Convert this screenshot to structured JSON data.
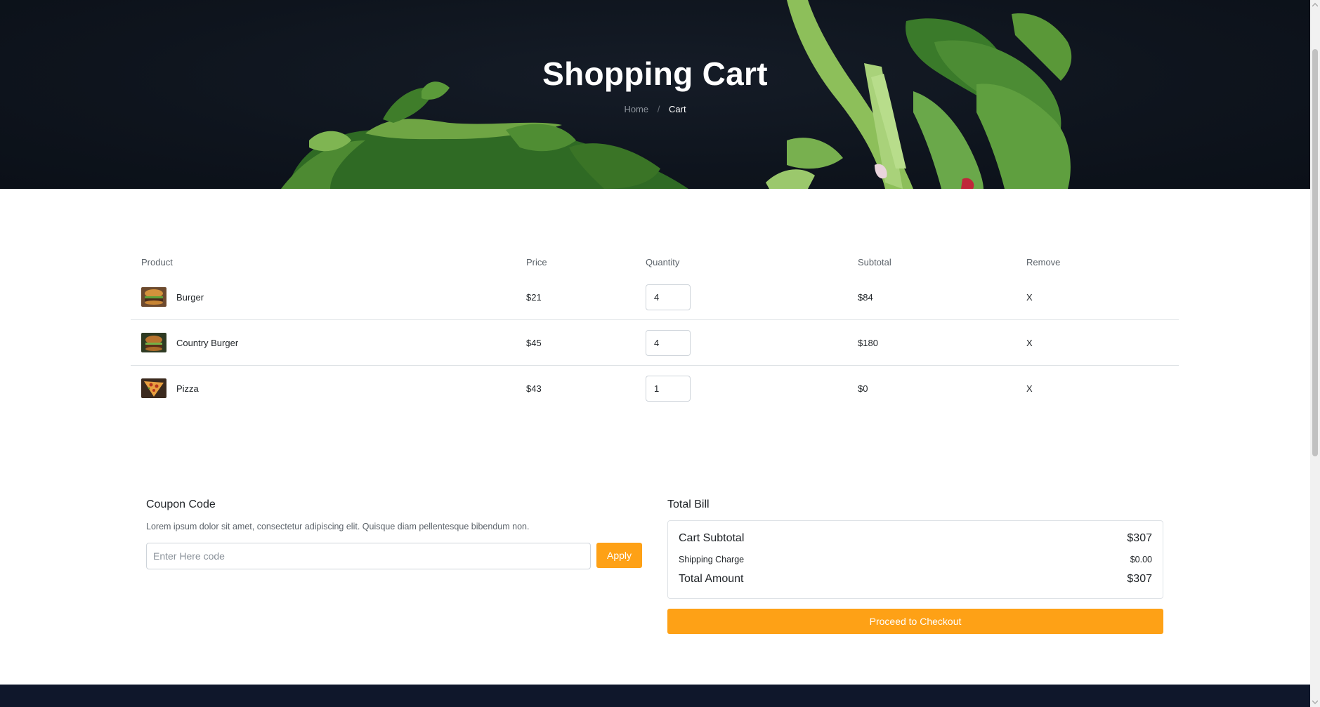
{
  "hero": {
    "title": "Shopping Cart",
    "breadcrumb": {
      "home": "Home",
      "separator": "/",
      "current": "Cart"
    }
  },
  "table": {
    "headers": {
      "product": "Product",
      "price": "Price",
      "quantity": "Quantity",
      "subtotal": "Subtotal",
      "remove": "Remove"
    },
    "rows": [
      {
        "name": "Burger",
        "price": "$21",
        "quantity": "4",
        "subtotal": "$84",
        "remove": "X",
        "thumb_color": "#b86a2a"
      },
      {
        "name": "Country Burger",
        "price": "$45",
        "quantity": "4",
        "subtotal": "$180",
        "remove": "X",
        "thumb_color": "#4d5a2a"
      },
      {
        "name": "Pizza",
        "price": "$43",
        "quantity": "1",
        "subtotal": "$0",
        "remove": "X",
        "thumb_color": "#c8782a"
      }
    ]
  },
  "coupon": {
    "title": "Coupon Code",
    "text": "Lorem ipsum dolor sit amet, consectetur adipiscing elit. Quisque diam pellentesque bibendum non.",
    "placeholder": "Enter Here code",
    "apply_label": "Apply"
  },
  "bill": {
    "title": "Total Bill",
    "cart_subtotal_label": "Cart Subtotal",
    "cart_subtotal_value": "$307",
    "shipping_label": "Shipping Charge",
    "shipping_value": "$0.00",
    "total_label": "Total Amount",
    "total_value": "$307",
    "checkout_label": "Proceed to Checkout"
  },
  "colors": {
    "accent": "#fea116",
    "hero_bg": "#0e141d",
    "footer_bg": "#0f172b"
  }
}
